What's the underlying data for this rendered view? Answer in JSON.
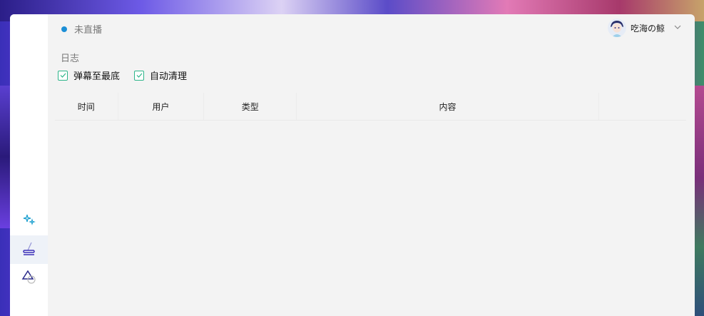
{
  "status": {
    "label": "未直播",
    "dot_color": "#1c8fd6"
  },
  "user": {
    "name": "吃海の鲸",
    "avatar_icon": "user-avatar"
  },
  "log": {
    "title": "日志",
    "options": [
      {
        "label": "弹幕至最底",
        "checked": true
      },
      {
        "label": "自动清理",
        "checked": true
      }
    ],
    "columns": [
      "时间",
      "用户",
      "类型",
      "内容",
      ""
    ],
    "rows": []
  },
  "sidebar": {
    "items": [
      {
        "icon": "sparkles-icon",
        "active": false
      },
      {
        "icon": "brush-icon",
        "active": true
      },
      {
        "icon": "shapes-icon",
        "active": false
      }
    ]
  },
  "colors": {
    "accent": "#2bb489",
    "brand": "#3a2fb8"
  }
}
